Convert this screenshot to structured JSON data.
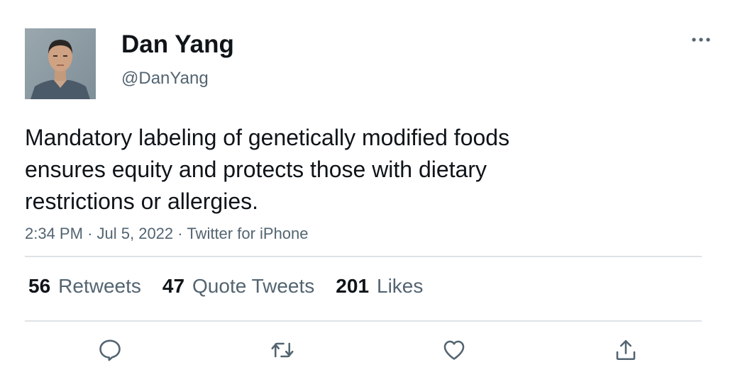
{
  "user": {
    "display_name": "Dan Yang",
    "handle": "@DanYang"
  },
  "tweet": {
    "text": "Mandatory labeling of genetically modified foods ensures equity and protects those with dietary restrictions or allergies.",
    "time": "2:34 PM",
    "separator": "·",
    "date": "Jul 5, 2022",
    "source": "Twitter for iPhone"
  },
  "stats": [
    {
      "count": "56",
      "label": "Retweets"
    },
    {
      "count": "47",
      "label": "Quote Tweets"
    },
    {
      "count": "201",
      "label": "Likes"
    }
  ],
  "icons": {
    "more": "more-horizontal-icon",
    "reply": "reply-bubble-icon",
    "retweet": "retweet-arrows-icon",
    "like": "heart-icon",
    "share": "share-upload-icon"
  },
  "colors": {
    "text_primary": "#0f1419",
    "text_secondary": "#536471",
    "divider": "#dfe3e6",
    "icon": "#536471"
  }
}
